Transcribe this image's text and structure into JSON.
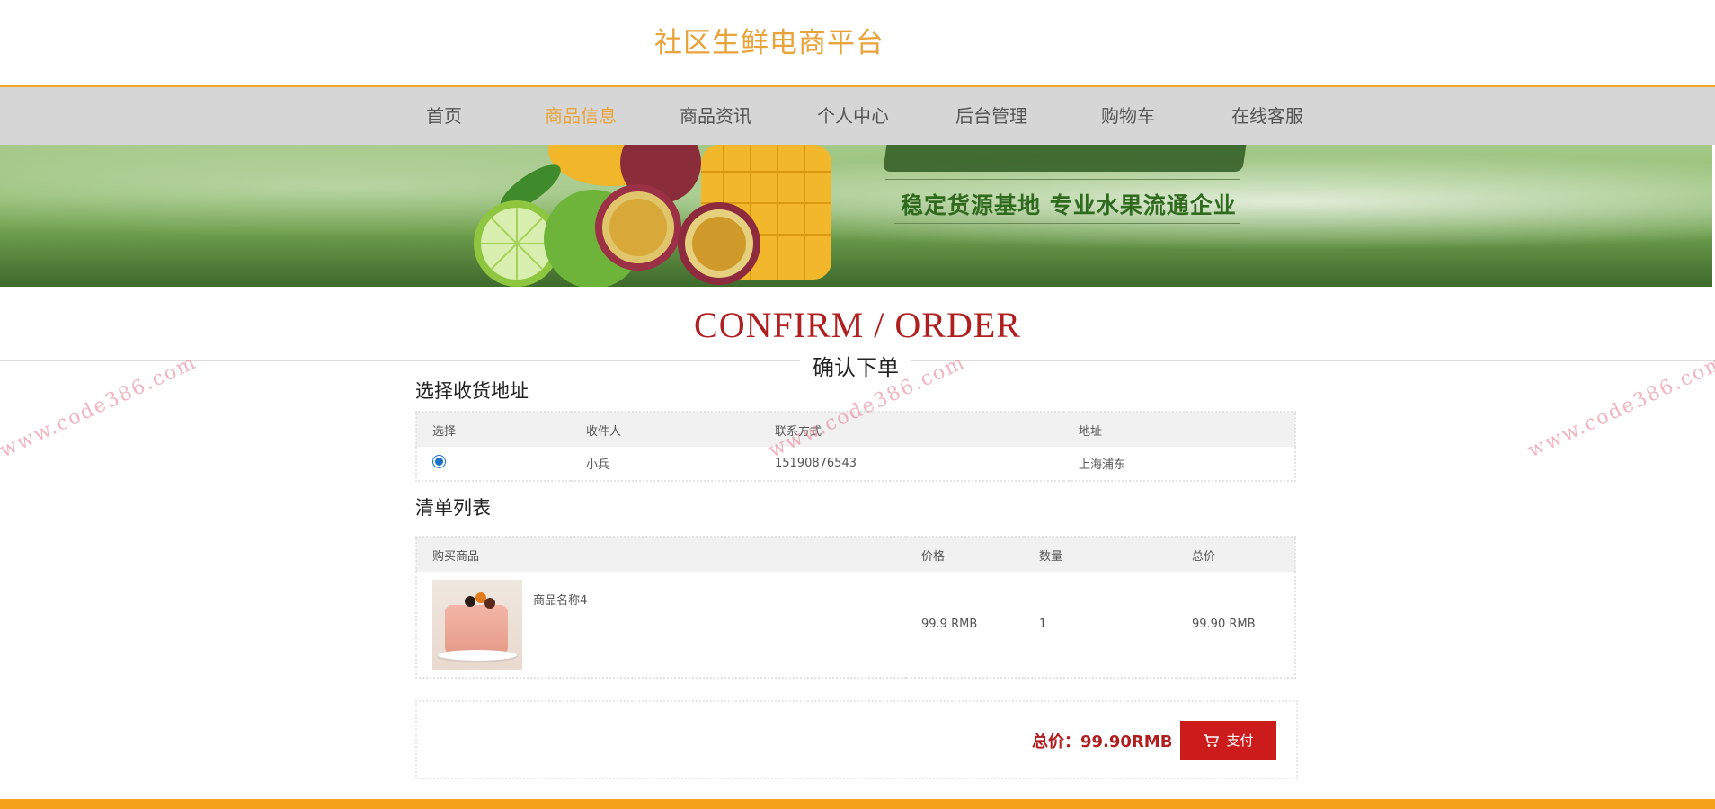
{
  "site": {
    "title": "社区生鲜电商平台"
  },
  "nav": {
    "items": [
      {
        "label": "首页"
      },
      {
        "label": "商品信息",
        "active": true
      },
      {
        "label": "商品资讯"
      },
      {
        "label": "个人中心"
      },
      {
        "label": "后台管理"
      },
      {
        "label": "购物车"
      },
      {
        "label": "在线客服"
      }
    ]
  },
  "banner": {
    "slogan": "稳定货源基地 专业水果流通企业"
  },
  "page": {
    "title_en": "CONFIRM / ORDER",
    "title_cn": "确认下单"
  },
  "address": {
    "section_title": "选择收货地址",
    "headers": [
      "选择",
      "收件人",
      "联系方式",
      "地址"
    ],
    "rows": [
      {
        "selected": true,
        "recipient": "小兵",
        "phone": "15190876543",
        "address": "上海浦东"
      }
    ]
  },
  "order": {
    "section_title": "清单列表",
    "headers": [
      "购买商品",
      "价格",
      "数量",
      "总价"
    ],
    "items": [
      {
        "name": "商品名称4",
        "price": "99.9 RMB",
        "quantity": "1",
        "total": "99.90 RMB"
      }
    ]
  },
  "summary": {
    "total_label": "总价：99.90RMB",
    "pay_label": "支付"
  },
  "watermark": "www.code386.com",
  "colors": {
    "accent": "#e8a33a",
    "nav_bg": "#d6d6d6",
    "title_red": "#b01f1f",
    "pay_red": "#cc1b1b",
    "footer": "#f5a11a"
  }
}
